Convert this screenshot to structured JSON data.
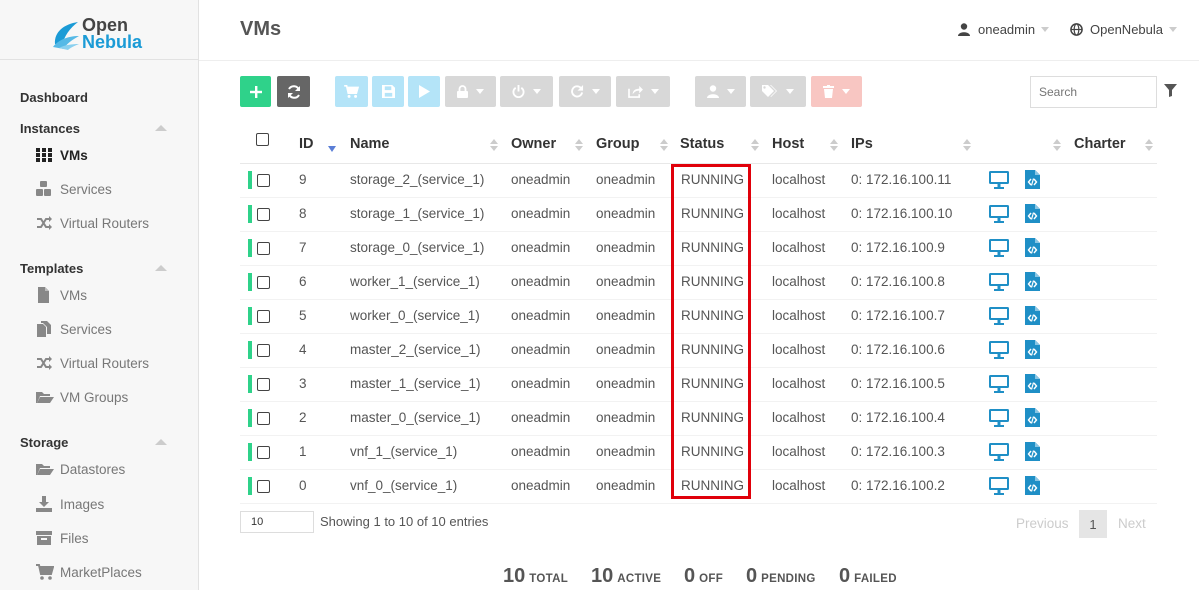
{
  "app": {
    "logo_line1": "Open",
    "logo_line2": "Nebula",
    "page_title": "VMs",
    "user": "oneadmin",
    "zone": "OpenNebula"
  },
  "sidebar": {
    "dashboard": "Dashboard",
    "instances": {
      "label": "Instances",
      "items": [
        "VMs",
        "Services",
        "Virtual Routers"
      ]
    },
    "templates": {
      "label": "Templates",
      "items": [
        "VMs",
        "Services",
        "Virtual Routers",
        "VM Groups"
      ]
    },
    "storage": {
      "label": "Storage",
      "items": [
        "Datastores",
        "Images",
        "Files",
        "MarketPlaces"
      ]
    }
  },
  "toolbar": {
    "search_placeholder": "Search"
  },
  "table": {
    "columns": [
      "ID",
      "Name",
      "Owner",
      "Group",
      "Status",
      "Host",
      "IPs",
      "Charter"
    ],
    "rows": [
      {
        "id": "9",
        "name": "storage_2_(service_1)",
        "owner": "oneadmin",
        "group": "oneadmin",
        "status": "RUNNING",
        "host": "localhost",
        "ips": "0: 172.16.100.11"
      },
      {
        "id": "8",
        "name": "storage_1_(service_1)",
        "owner": "oneadmin",
        "group": "oneadmin",
        "status": "RUNNING",
        "host": "localhost",
        "ips": "0: 172.16.100.10"
      },
      {
        "id": "7",
        "name": "storage_0_(service_1)",
        "owner": "oneadmin",
        "group": "oneadmin",
        "status": "RUNNING",
        "host": "localhost",
        "ips": "0: 172.16.100.9"
      },
      {
        "id": "6",
        "name": "worker_1_(service_1)",
        "owner": "oneadmin",
        "group": "oneadmin",
        "status": "RUNNING",
        "host": "localhost",
        "ips": "0: 172.16.100.8"
      },
      {
        "id": "5",
        "name": "worker_0_(service_1)",
        "owner": "oneadmin",
        "group": "oneadmin",
        "status": "RUNNING",
        "host": "localhost",
        "ips": "0: 172.16.100.7"
      },
      {
        "id": "4",
        "name": "master_2_(service_1)",
        "owner": "oneadmin",
        "group": "oneadmin",
        "status": "RUNNING",
        "host": "localhost",
        "ips": "0: 172.16.100.6"
      },
      {
        "id": "3",
        "name": "master_1_(service_1)",
        "owner": "oneadmin",
        "group": "oneadmin",
        "status": "RUNNING",
        "host": "localhost",
        "ips": "0: 172.16.100.5"
      },
      {
        "id": "2",
        "name": "master_0_(service_1)",
        "owner": "oneadmin",
        "group": "oneadmin",
        "status": "RUNNING",
        "host": "localhost",
        "ips": "0: 172.16.100.4"
      },
      {
        "id": "1",
        "name": "vnf_1_(service_1)",
        "owner": "oneadmin",
        "group": "oneadmin",
        "status": "RUNNING",
        "host": "localhost",
        "ips": "0: 172.16.100.3"
      },
      {
        "id": "0",
        "name": "vnf_0_(service_1)",
        "owner": "oneadmin",
        "group": "oneadmin",
        "status": "RUNNING",
        "host": "localhost",
        "ips": "0: 172.16.100.2"
      }
    ]
  },
  "pagination": {
    "page_length": "10",
    "entries_text": "Showing 1 to 10 of 10 entries",
    "previous": "Previous",
    "current": "1",
    "next": "Next"
  },
  "summary": {
    "total": {
      "n": "10",
      "label": "TOTAL"
    },
    "active": {
      "n": "10",
      "label": "ACTIVE"
    },
    "off": {
      "n": "0",
      "label": "OFF"
    },
    "pending": {
      "n": "0",
      "label": "PENDING"
    },
    "failed": {
      "n": "0",
      "label": "FAILED"
    }
  },
  "colors": {
    "brand_blue": "#1b9bd6",
    "running_green": "#2fd28a",
    "highlight_red": "#e0000a",
    "icon_blue": "#1f8fc6"
  }
}
